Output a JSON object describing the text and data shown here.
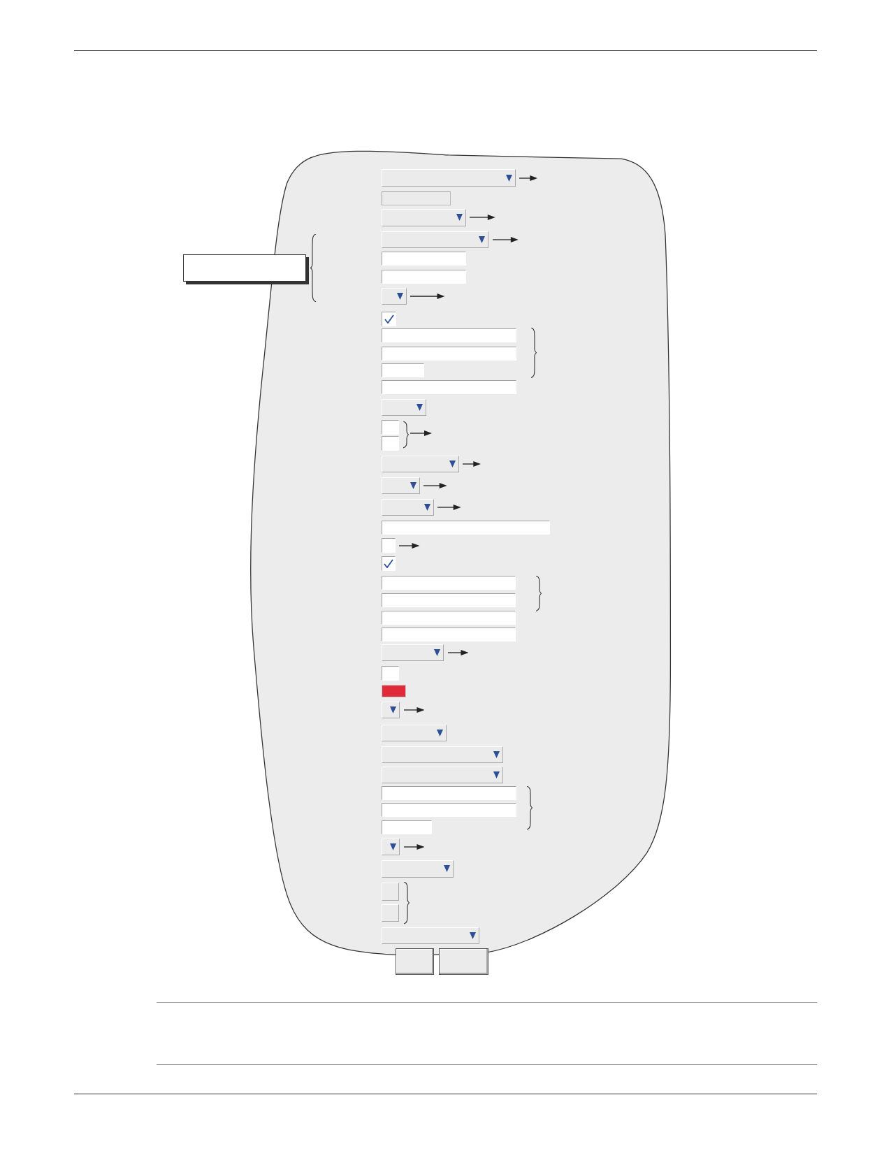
{
  "dialog": {
    "controls": [
      {
        "kind": "dropdown"
      },
      {
        "kind": "textbox",
        "disabled": true
      },
      {
        "kind": "dropdown"
      },
      {
        "kind": "dropdown"
      },
      {
        "kind": "textbox",
        "disabled": false
      },
      {
        "kind": "textbox",
        "disabled": false
      },
      {
        "kind": "dropdown"
      },
      {
        "kind": "checkbox",
        "checked": true
      },
      {
        "kind": "textbox",
        "disabled": false
      },
      {
        "kind": "textbox",
        "disabled": false
      },
      {
        "kind": "textbox",
        "disabled": false
      },
      {
        "kind": "textbox",
        "disabled": false
      },
      {
        "kind": "dropdown"
      },
      {
        "kind": "checkbox",
        "checked": false
      },
      {
        "kind": "checkbox",
        "checked": false
      },
      {
        "kind": "dropdown"
      },
      {
        "kind": "dropdown"
      },
      {
        "kind": "dropdown"
      },
      {
        "kind": "textbox",
        "disabled": false
      },
      {
        "kind": "checkbox",
        "checked": false
      },
      {
        "kind": "checkbox",
        "checked": true
      },
      {
        "kind": "textbox",
        "disabled": false
      },
      {
        "kind": "textbox",
        "disabled": false
      },
      {
        "kind": "textbox",
        "disabled": false
      },
      {
        "kind": "textbox",
        "disabled": false
      },
      {
        "kind": "dropdown"
      },
      {
        "kind": "checkbox",
        "checked": false
      },
      {
        "kind": "swatch",
        "color": "#e02a3a"
      },
      {
        "kind": "dropdown"
      },
      {
        "kind": "dropdown"
      },
      {
        "kind": "dropdown"
      },
      {
        "kind": "dropdown"
      },
      {
        "kind": "textbox",
        "disabled": false
      },
      {
        "kind": "textbox",
        "disabled": false
      },
      {
        "kind": "textbox",
        "disabled": false
      },
      {
        "kind": "dropdown"
      },
      {
        "kind": "dropdown"
      },
      {
        "kind": "box"
      },
      {
        "kind": "box"
      },
      {
        "kind": "dropdown"
      }
    ],
    "buttons": [
      {
        "kind": "button"
      },
      {
        "kind": "button"
      }
    ]
  }
}
